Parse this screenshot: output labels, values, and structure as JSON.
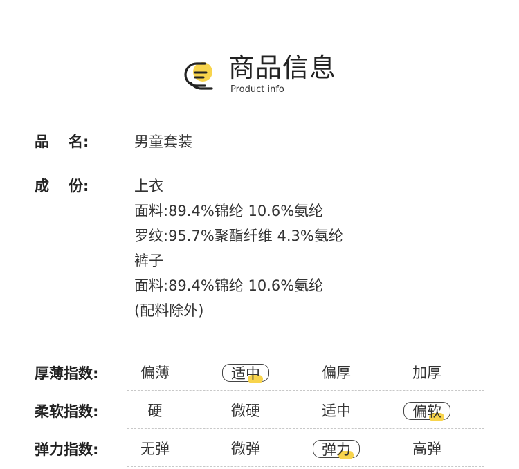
{
  "header": {
    "title": "商品信息",
    "subtitle": "Product info",
    "accent_color": "#f8d44c",
    "icon": "list-bubble-icon"
  },
  "fields": {
    "name": {
      "label_chars": [
        "品",
        "名:"
      ],
      "value": "男童套装"
    },
    "composition": {
      "label_chars": [
        "成",
        "份:"
      ],
      "lines": [
        "上衣",
        "面料:89.4%锦纶 10.6%氨纶",
        "罗纹:95.7%聚酯纤维 4.3%氨纶",
        "裤子",
        "面料:89.4%锦纶 10.6%氨纶",
        "(配料除外)"
      ]
    }
  },
  "scales": [
    {
      "label": "厚薄指数:",
      "options": [
        "偏薄",
        "适中",
        "偏厚",
        "加厚"
      ],
      "selected_index": 1
    },
    {
      "label": "柔软指数:",
      "options": [
        "硬",
        "微硬",
        "适中",
        "偏软"
      ],
      "selected_index": 3
    },
    {
      "label": "弹力指数:",
      "options": [
        "无弹",
        "微弹",
        "弹力",
        "高弹"
      ],
      "selected_index": 2
    }
  ]
}
